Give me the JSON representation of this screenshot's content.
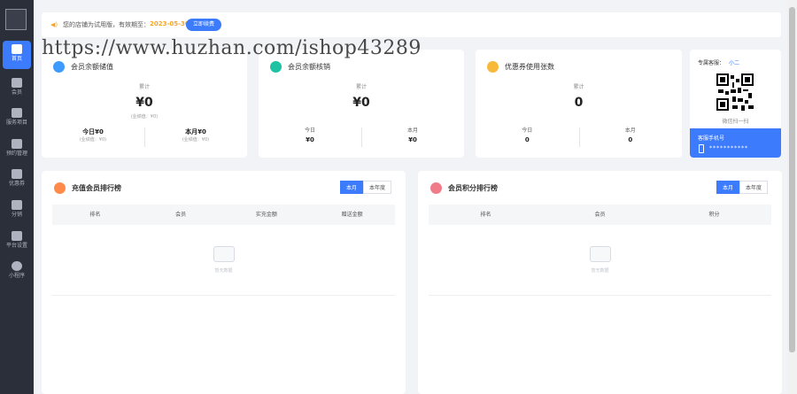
{
  "sidebar": {
    "items": [
      {
        "label": "首页",
        "icon": "home-icon",
        "active": true
      },
      {
        "label": "会员",
        "icon": "member-icon",
        "active": false
      },
      {
        "label": "服务项目",
        "icon": "folder-icon",
        "active": false
      },
      {
        "label": "预约管理",
        "icon": "calendar-icon",
        "active": false
      },
      {
        "label": "优惠券",
        "icon": "coupon-icon",
        "active": false
      },
      {
        "label": "分销",
        "icon": "headset-icon",
        "active": false
      },
      {
        "label": "平台设置",
        "icon": "store-icon",
        "active": false
      },
      {
        "label": "小程序",
        "icon": "miniprogram-icon",
        "active": false
      }
    ]
  },
  "notice": {
    "message": "您的店铺为试用版，有效期至：",
    "expiry_date": "2023-05-30",
    "renew_label": "立即续费"
  },
  "watermark": "https://www.huzhan.com/ishop43289",
  "stats": [
    {
      "title": "会员余额储值",
      "icon_color": "#3d9bfd",
      "total_label": "累计",
      "total_value": "¥0",
      "total_sub": "(业绩值：¥0)",
      "today_label": "今日¥0",
      "today_sub": "(业绩值：¥0)",
      "month_label": "本月¥0",
      "month_sub": "(业绩值：¥0)"
    },
    {
      "title": "会员余额核销",
      "icon_color": "#1fc3a3",
      "total_label": "累计",
      "total_value": "¥0",
      "today_label": "今日",
      "today_value": "¥0",
      "month_label": "本月",
      "month_value": "¥0"
    },
    {
      "title": "优惠券使用张数",
      "icon_color": "#f7b93a",
      "total_label": "累计",
      "total_value": "0",
      "today_label": "今日",
      "today_value": "0",
      "month_label": "本月",
      "month_value": "0"
    }
  ],
  "service": {
    "title": "专属客服：",
    "name": "小二",
    "qr_tip": "微信扫一扫",
    "phone_label": "客服手机号",
    "phone_value": "***********"
  },
  "panels": [
    {
      "title": "充值会员排行榜",
      "icon_color": "#ff8a4c",
      "tabs": [
        "本月",
        "本年度"
      ],
      "columns": [
        "排名",
        "会员",
        "实充金额",
        "赠送金额"
      ],
      "empty_text": "暂无数据"
    },
    {
      "title": "会员积分排行榜",
      "icon_color": "#f07c8a",
      "tabs": [
        "本月",
        "本年度"
      ],
      "columns": [
        "排名",
        "会员",
        "积分"
      ],
      "empty_text": "暂无数据"
    }
  ],
  "colors": {
    "primary": "#3d7bfd",
    "sidebar_bg": "#2b2f3a",
    "warning": "#f5a623"
  }
}
